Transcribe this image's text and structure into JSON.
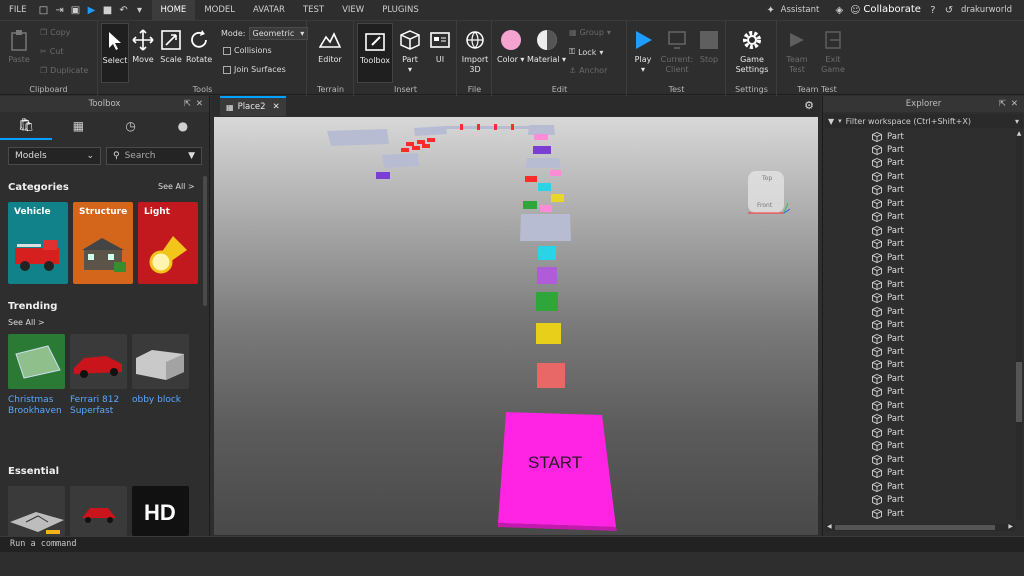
{
  "menu": {
    "file": "FILE",
    "tabs": [
      "HOME",
      "MODEL",
      "AVATAR",
      "TEST",
      "VIEW",
      "PLUGINS"
    ],
    "assistant": "Assistant",
    "collaborate": "Collaborate",
    "username": "drakurworld"
  },
  "ribbon": {
    "clipboard": {
      "label": "Clipboard",
      "paste": "Paste",
      "copy": "Copy",
      "cut": "Cut",
      "duplicate": "Duplicate"
    },
    "tools": {
      "label": "Tools",
      "select": "Select",
      "move": "Move",
      "scale": "Scale",
      "rotate": "Rotate",
      "mode_label": "Mode:",
      "mode_value": "Geometric",
      "collisions": "Collisions",
      "join_surfaces": "Join Surfaces"
    },
    "terrain": {
      "label": "Terrain",
      "editor": "Editor"
    },
    "insert": {
      "label": "Insert",
      "toolbox": "Toolbox",
      "part": "Part",
      "ui": "UI"
    },
    "file": {
      "label": "File",
      "import3d": "Import 3D"
    },
    "edit": {
      "label": "Edit",
      "color": "Color",
      "material": "Material",
      "group": "Group",
      "lock": "Lock",
      "anchor": "Anchor"
    },
    "test": {
      "label": "Test",
      "play": "Play",
      "current_client": "Current: Client",
      "stop": "Stop"
    },
    "settings": {
      "label": "Settings",
      "game_settings": "Game Settings"
    },
    "team_test": {
      "label": "Team Test",
      "team_test": "Team Test",
      "exit_game": "Exit Game"
    }
  },
  "toolbox": {
    "title": "Toolbox",
    "dropdown": "Models",
    "search_placeholder": "Search",
    "categories_title": "Categories",
    "see_all": "See All >",
    "categories": [
      {
        "name": "Vehicle",
        "color": "#11818a"
      },
      {
        "name": "Structure",
        "color": "#d4661b"
      },
      {
        "name": "Light",
        "color": "#c2191e"
      }
    ],
    "trending_title": "Trending",
    "trending_see_all": "See All >",
    "trending": [
      {
        "name": "Christmas Brookhaven"
      },
      {
        "name": "Ferrari 812 Superfast"
      },
      {
        "name": "obby block"
      }
    ],
    "essential_title": "Essential"
  },
  "viewport": {
    "tab": "Place2",
    "start_text": "START",
    "viewcube": {
      "top": "Top",
      "front": "Front"
    }
  },
  "explorer": {
    "title": "Explorer",
    "filter_placeholder": "Filter workspace (Ctrl+Shift+X)",
    "item_label": "Part"
  },
  "command": {
    "placeholder": "Run a command"
  }
}
